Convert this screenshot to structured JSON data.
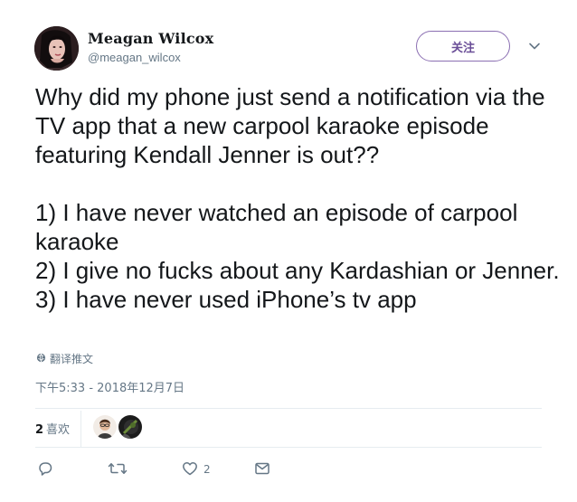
{
  "author": {
    "display_name": "Meagan Wilcox",
    "screen_name": "@meagan_wilcox",
    "avatar_icon": "user-avatar"
  },
  "follow_button_label": "关注",
  "tweet": {
    "text": "Why did my phone just send a notification via the TV app that a new carpool karaoke episode featuring Kendall Jenner is out??\n\n1) I have never watched an episode of carpool karaoke\n2) I give no fucks about any Kardashian or Jenner.\n3) I have never used iPhone’s tv app",
    "translate_label": "翻译推文",
    "timestamp": "下午5:33 - 2018年12月7日"
  },
  "stats": {
    "likes_count": "2",
    "likes_label": "喜欢"
  },
  "actions": {
    "reply_count": "",
    "retweet_count": "",
    "like_count": "2"
  },
  "colors": {
    "follow_border": "#8b6fb2",
    "secondary_text": "#657786",
    "divider": "#e6ecf0"
  }
}
